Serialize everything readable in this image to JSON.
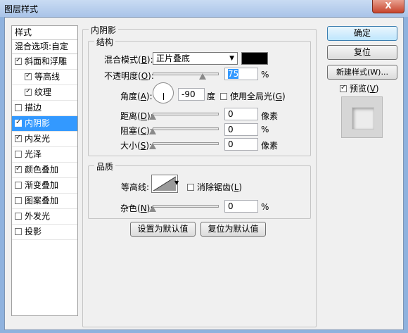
{
  "window": {
    "title": "图层样式",
    "close_glyph": "X"
  },
  "styles_panel": {
    "header": "样式",
    "blending_options": "混合选项:自定",
    "items": [
      {
        "label": "斜面和浮雕",
        "checked": true,
        "sub": false,
        "selected": false
      },
      {
        "label": "等高线",
        "checked": true,
        "sub": true,
        "selected": false
      },
      {
        "label": "纹理",
        "checked": true,
        "sub": true,
        "selected": false
      },
      {
        "label": "描边",
        "checked": false,
        "sub": false,
        "selected": false
      },
      {
        "label": "内阴影",
        "checked": true,
        "sub": false,
        "selected": true
      },
      {
        "label": "内发光",
        "checked": true,
        "sub": false,
        "selected": false
      },
      {
        "label": "光泽",
        "checked": false,
        "sub": false,
        "selected": false
      },
      {
        "label": "颜色叠加",
        "checked": true,
        "sub": false,
        "selected": false
      },
      {
        "label": "渐变叠加",
        "checked": false,
        "sub": false,
        "selected": false
      },
      {
        "label": "图案叠加",
        "checked": false,
        "sub": false,
        "selected": false
      },
      {
        "label": "外发光",
        "checked": false,
        "sub": false,
        "selected": false
      },
      {
        "label": "投影",
        "checked": false,
        "sub": false,
        "selected": false
      }
    ]
  },
  "inner_shadow": {
    "group_title": "内阴影",
    "structure_title": "结构",
    "blend_mode_label_pre": "混合模式(",
    "blend_mode_key": "B",
    "blend_mode_label_post": "):",
    "blend_mode_value": "正片叠底",
    "color": "#000000",
    "opacity_label_pre": "不透明度(",
    "opacity_key": "O",
    "opacity_label_post": "):",
    "opacity_value": "75",
    "opacity_fraction": 0.75,
    "percent": "%",
    "angle_label_pre": "角度(",
    "angle_key": "A",
    "angle_label_post": "):",
    "angle_value": "-90",
    "degree": "度",
    "global_light_pre": "使用全局光(",
    "global_light_key": "G",
    "global_light_post": ")",
    "distance_label_pre": "距离(",
    "distance_key": "D",
    "distance_label_post": "):",
    "distance_value": "0",
    "choke_label_pre": "阻塞(",
    "choke_key": "C",
    "choke_label_post": "):",
    "choke_value": "0",
    "size_label_pre": "大小(",
    "size_key": "S",
    "size_label_post": "):",
    "size_value": "0",
    "pixels": "像素"
  },
  "quality": {
    "title": "品质",
    "contour_label": "等高线:",
    "antialias_pre": "消除锯齿(",
    "antialias_key": "L",
    "antialias_post": ")",
    "noise_label_pre": "杂色(",
    "noise_key": "N",
    "noise_label_post": "):",
    "noise_value": "0",
    "percent": "%"
  },
  "bottom_buttons": {
    "make_default": "设置为默认值",
    "reset_default": "复位为默认值"
  },
  "right_panel": {
    "ok": "确定",
    "reset": "复位",
    "new_style": "新建样式(W)...",
    "preview_pre": "预览(",
    "preview_key": "V",
    "preview_post": ")"
  }
}
